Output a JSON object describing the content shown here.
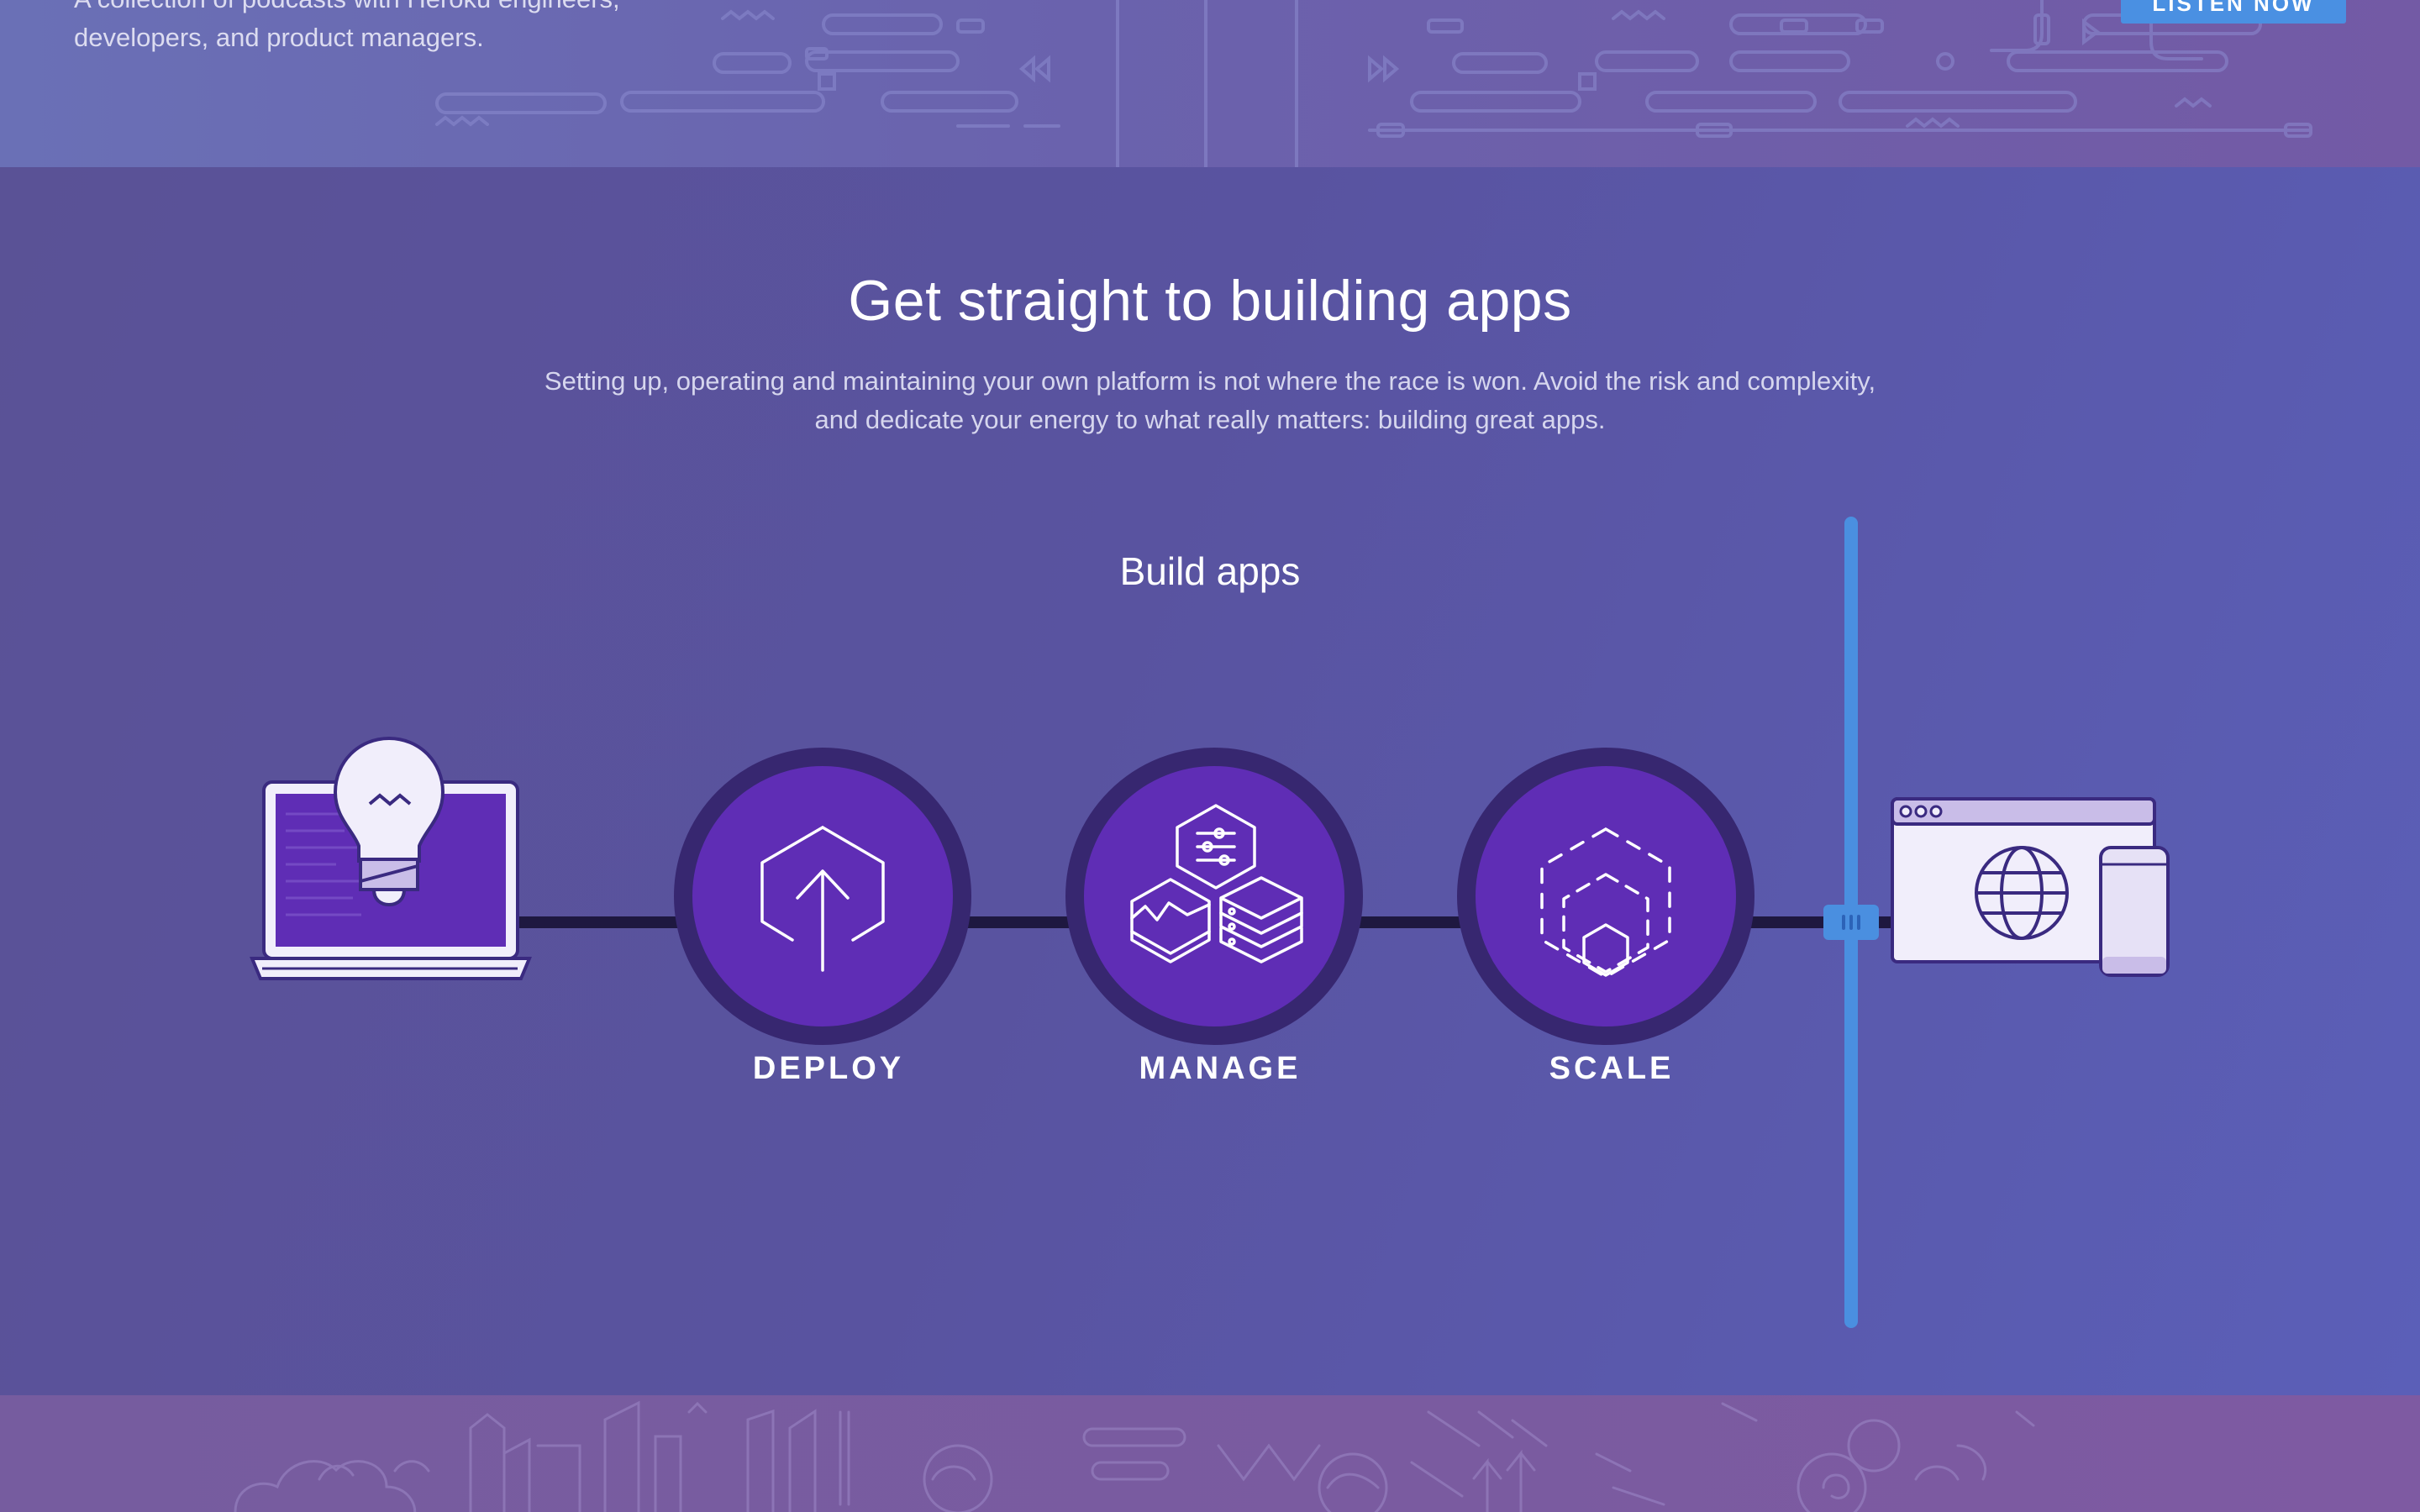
{
  "podcast_band": {
    "description": "A collection of podcasts with Heroku engineers, developers, and product managers.",
    "button_label": "LISTEN NOW"
  },
  "main": {
    "title": "Get straight to building apps",
    "subtitle": "Setting up, operating and maintaining your own platform is not where the race is won. Avoid the risk and complexity, and dedicate your energy to what really matters: building great apps.",
    "diagram_title": "Build apps",
    "stages": [
      {
        "label": "DEPLOY",
        "icon": "upload-hexagon-icon"
      },
      {
        "label": "MANAGE",
        "icon": "manage-hexagons-icon"
      },
      {
        "label": "SCALE",
        "icon": "scale-hexagons-icon"
      }
    ],
    "start_icon": "laptop-lightbulb-icon",
    "end_icon": "browser-mobile-icon"
  },
  "colors": {
    "accent_blue": "#4a90e2",
    "stage_purple": "#5f2db5",
    "ring_dark": "#372770",
    "track_dark": "#1e1840"
  }
}
